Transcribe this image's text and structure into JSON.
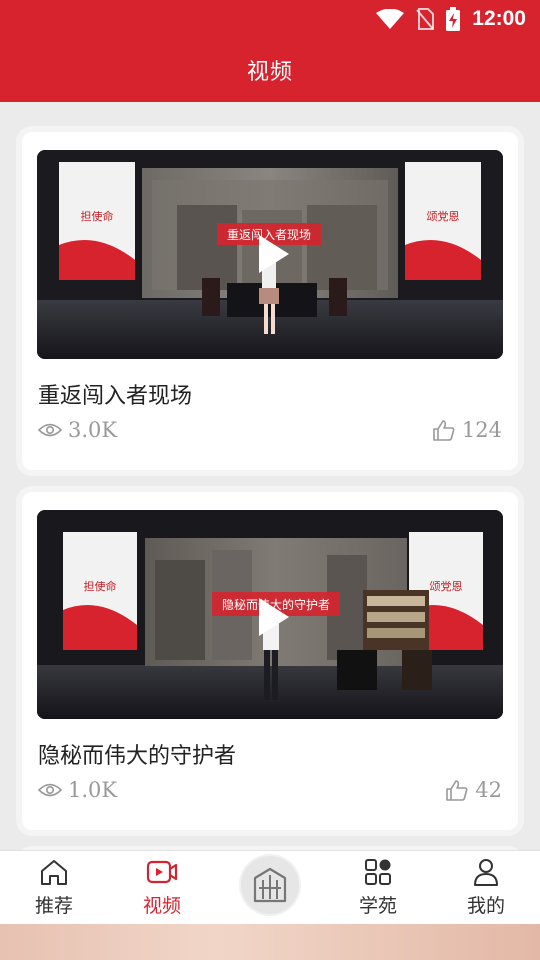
{
  "status_bar": {
    "time": "12:00"
  },
  "header": {
    "title": "视频"
  },
  "videos": [
    {
      "title": "重返闯入者现场",
      "views": "3.0K",
      "likes": "124",
      "banner_text": "重返闯入者现场",
      "left_sign": "担使命",
      "right_sign": "颂党恩"
    },
    {
      "title": "隐秘而伟大的守护者",
      "views": "1.0K",
      "likes": "42",
      "banner_text": "隐秘而伟大的守护者",
      "left_sign": "担使命",
      "right_sign": "颂党恩"
    }
  ],
  "tabs": [
    {
      "label": "推荐",
      "icon": "home-icon",
      "active": false
    },
    {
      "label": "视频",
      "icon": "video-icon",
      "active": true
    },
    {
      "label": "",
      "icon": "emblem-icon",
      "active": false
    },
    {
      "label": "学苑",
      "icon": "apps-icon",
      "active": false
    },
    {
      "label": "我的",
      "icon": "profile-icon",
      "active": false
    }
  ],
  "colors": {
    "brand_red": "#d7232e",
    "muted": "#999999",
    "text": "#222222"
  }
}
